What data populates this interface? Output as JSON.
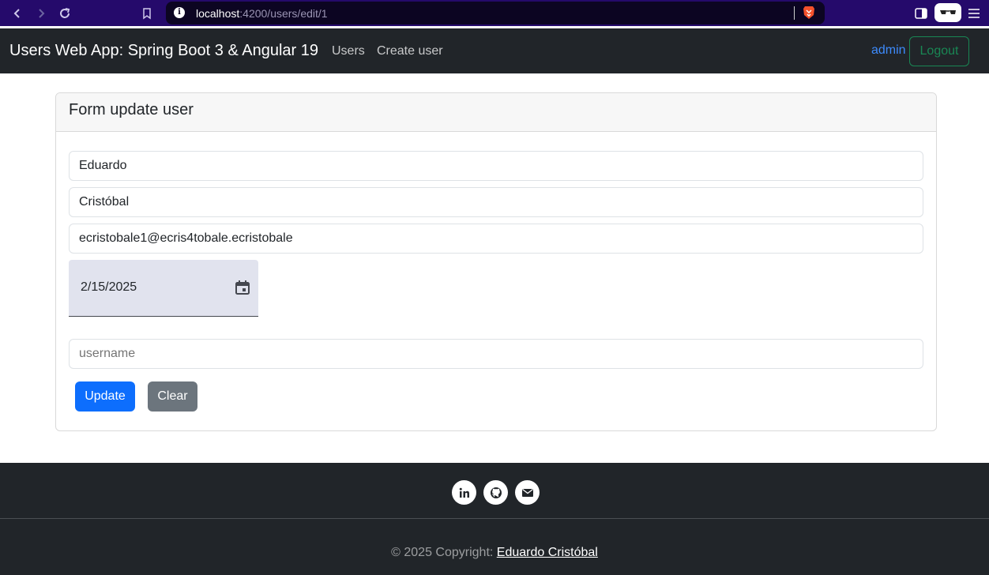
{
  "browser": {
    "url_host": "localhost",
    "url_path": ":4200/users/edit/1",
    "icons": [
      "back-icon",
      "forward-icon",
      "reload-icon",
      "bookmark-icon",
      "site-info-icon",
      "brave-shields-icon",
      "sidebar-icon",
      "glasses-icon",
      "menu-icon"
    ]
  },
  "navbar": {
    "brand": "Users Web App: Spring Boot 3 & Angular 19",
    "links": [
      "Users",
      "Create user"
    ],
    "user": "admin",
    "logout_label": "Logout"
  },
  "form": {
    "title": "Form update user",
    "name_value": "Eduardo",
    "lastname_value": "Cristóbal",
    "email_value": "ecristobale1@ecris4tobale.ecristobale",
    "date_value": "2/15/2025",
    "username_placeholder": "username",
    "update_label": "Update",
    "clear_label": "Clear"
  },
  "footer": {
    "social_icons": [
      "linkedin-icon",
      "github-icon",
      "email-icon"
    ],
    "copyright_prefix": "© 2025 Copyright: ",
    "copyright_author": "Eduardo Cristóbal"
  },
  "colors": {
    "browser_bar": "#250a6b",
    "navbar": "#212529",
    "primary": "#0d6efd",
    "secondary": "#6c757d",
    "success": "#198754"
  }
}
